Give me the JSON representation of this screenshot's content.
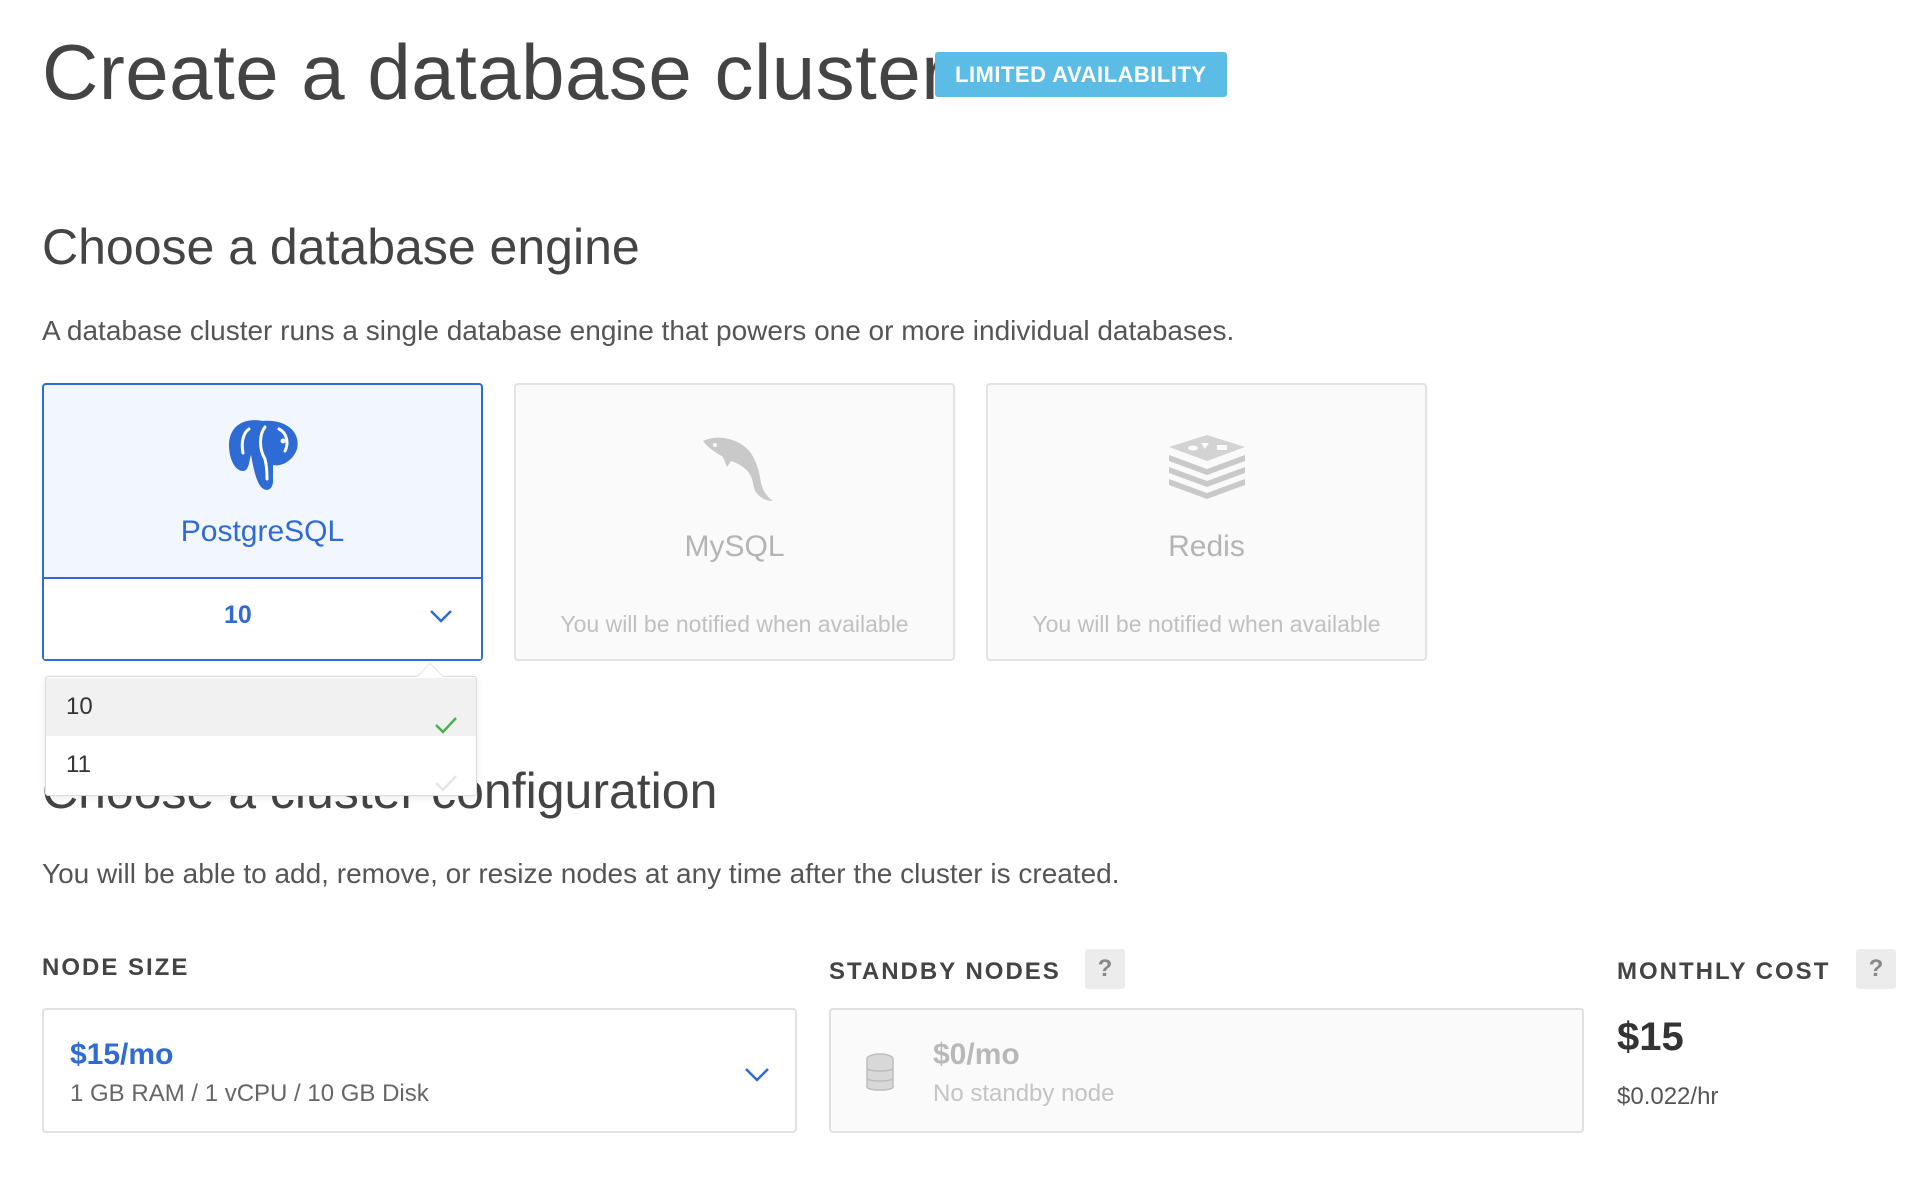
{
  "header": {
    "title": "Create a database cluster",
    "badge": "LIMITED AVAILABILITY"
  },
  "engine_section": {
    "heading": "Choose a database engine",
    "description": "A database cluster runs a single database engine that powers one or more individual databases.",
    "engines": [
      {
        "name": "PostgreSQL",
        "icon": "postgresql-elephant-icon",
        "selected": true,
        "version": "10"
      },
      {
        "name": "MySQL",
        "icon": "mysql-dolphin-icon",
        "selected": false,
        "note": "You will be notified when available"
      },
      {
        "name": "Redis",
        "icon": "redis-stack-icon",
        "selected": false,
        "note": "You will be notified when available"
      }
    ],
    "version_options": [
      {
        "label": "10",
        "checked": true
      },
      {
        "label": "11",
        "checked": false
      }
    ]
  },
  "config_section": {
    "heading": "Choose a cluster configuration",
    "description": "You will be able to add, remove, or resize nodes at any time after the cluster is created.",
    "node_size": {
      "label": "NODE SIZE",
      "price": "$15/mo",
      "specs": "1 GB RAM / 1 vCPU / 10 GB Disk"
    },
    "standby": {
      "label": "STANDBY NODES",
      "help": "?",
      "price": "$0/mo",
      "detail": "No standby node"
    },
    "monthly_cost": {
      "label": "MONTHLY COST",
      "help": "?",
      "amount": "$15",
      "hourly": "$0.022/hr"
    }
  },
  "colors": {
    "accent": "#2e6bd4",
    "badge": "#5bbde6",
    "check": "#4caf50"
  }
}
